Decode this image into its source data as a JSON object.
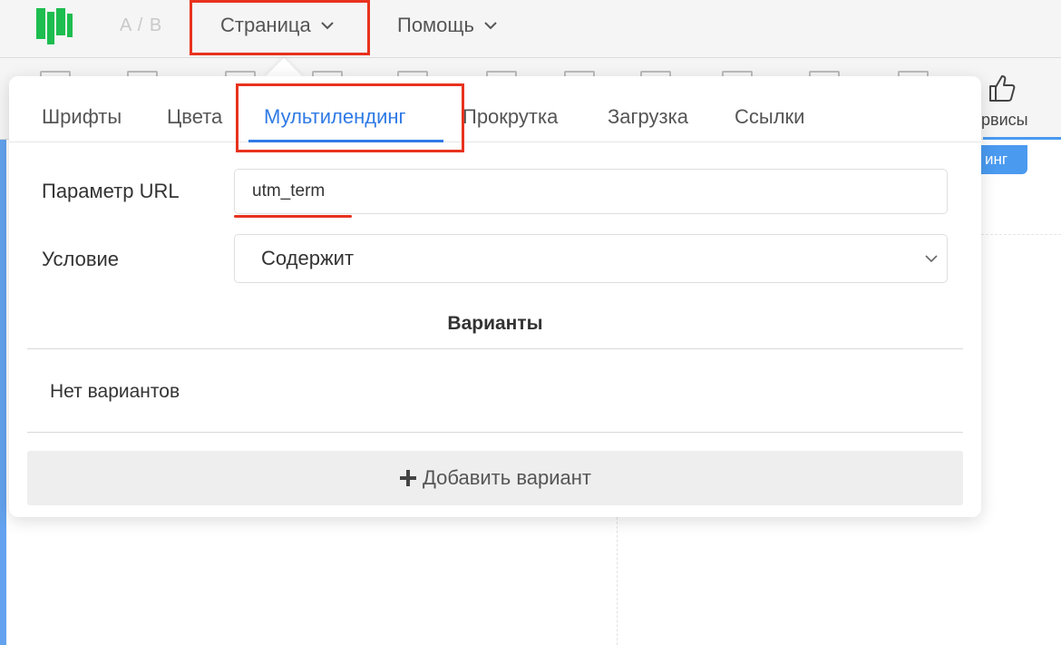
{
  "topbar": {
    "logo_icon": "bar-chart-logo-icon",
    "ab_label": "A / B",
    "page_menu_label": "Страница",
    "help_menu_label": "Помощь"
  },
  "toolbar": {
    "services_label": "ервисы",
    "services_icon": "thumbs-up-icon",
    "chip_label": "инг"
  },
  "popup": {
    "tabs": [
      {
        "label": "Шрифты",
        "active": false
      },
      {
        "label": "Цвета",
        "active": false
      },
      {
        "label": "Мультилендинг",
        "active": true
      },
      {
        "label": "Прокрутка",
        "active": false
      },
      {
        "label": "Загрузка",
        "active": false
      },
      {
        "label": "Ссылки",
        "active": false
      }
    ],
    "url_param_label": "Параметр URL",
    "url_param_value": "utm_term",
    "condition_label": "Условие",
    "condition_value": "Содержит",
    "variants_title": "Варианты",
    "no_variants_text": "Нет вариантов",
    "add_variant_label": "Добавить вариант"
  },
  "colors": {
    "accent": "#2f7ae5",
    "highlight": "#e8321e",
    "logo_green": "#1dbd4f"
  }
}
